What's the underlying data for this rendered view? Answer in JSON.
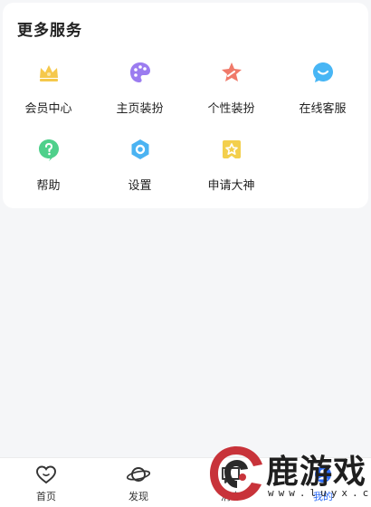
{
  "services": {
    "title": "更多服务",
    "items": [
      {
        "label": "会员中心",
        "icon": "crown-icon"
      },
      {
        "label": "主页装扮",
        "icon": "palette-icon"
      },
      {
        "label": "个性装扮",
        "icon": "star-icon"
      },
      {
        "label": "在线客服",
        "icon": "chat-smile-icon"
      },
      {
        "label": "帮助",
        "icon": "help-icon"
      },
      {
        "label": "设置",
        "icon": "settings-icon"
      },
      {
        "label": "申请大神",
        "icon": "badge-star-icon"
      }
    ]
  },
  "tabbar": {
    "tabs": [
      {
        "label": "首页",
        "icon": "heart-home-icon"
      },
      {
        "label": "发现",
        "icon": "planet-icon"
      },
      {
        "label": "消息",
        "icon": "message-icon"
      },
      {
        "label": "我的",
        "icon": "profile-icon"
      }
    ]
  },
  "watermark": {
    "title": "鹿游戏",
    "url": "www.luyx.cn"
  },
  "colors": {
    "crown": "#f5c84c",
    "palette": "#9b7cf0",
    "star": "#f07a6a",
    "chat": "#48b6f5",
    "help": "#4fd08b",
    "settings": "#4bb3f2",
    "badge": "#f3cf4d",
    "background": "#f5f6f8"
  }
}
